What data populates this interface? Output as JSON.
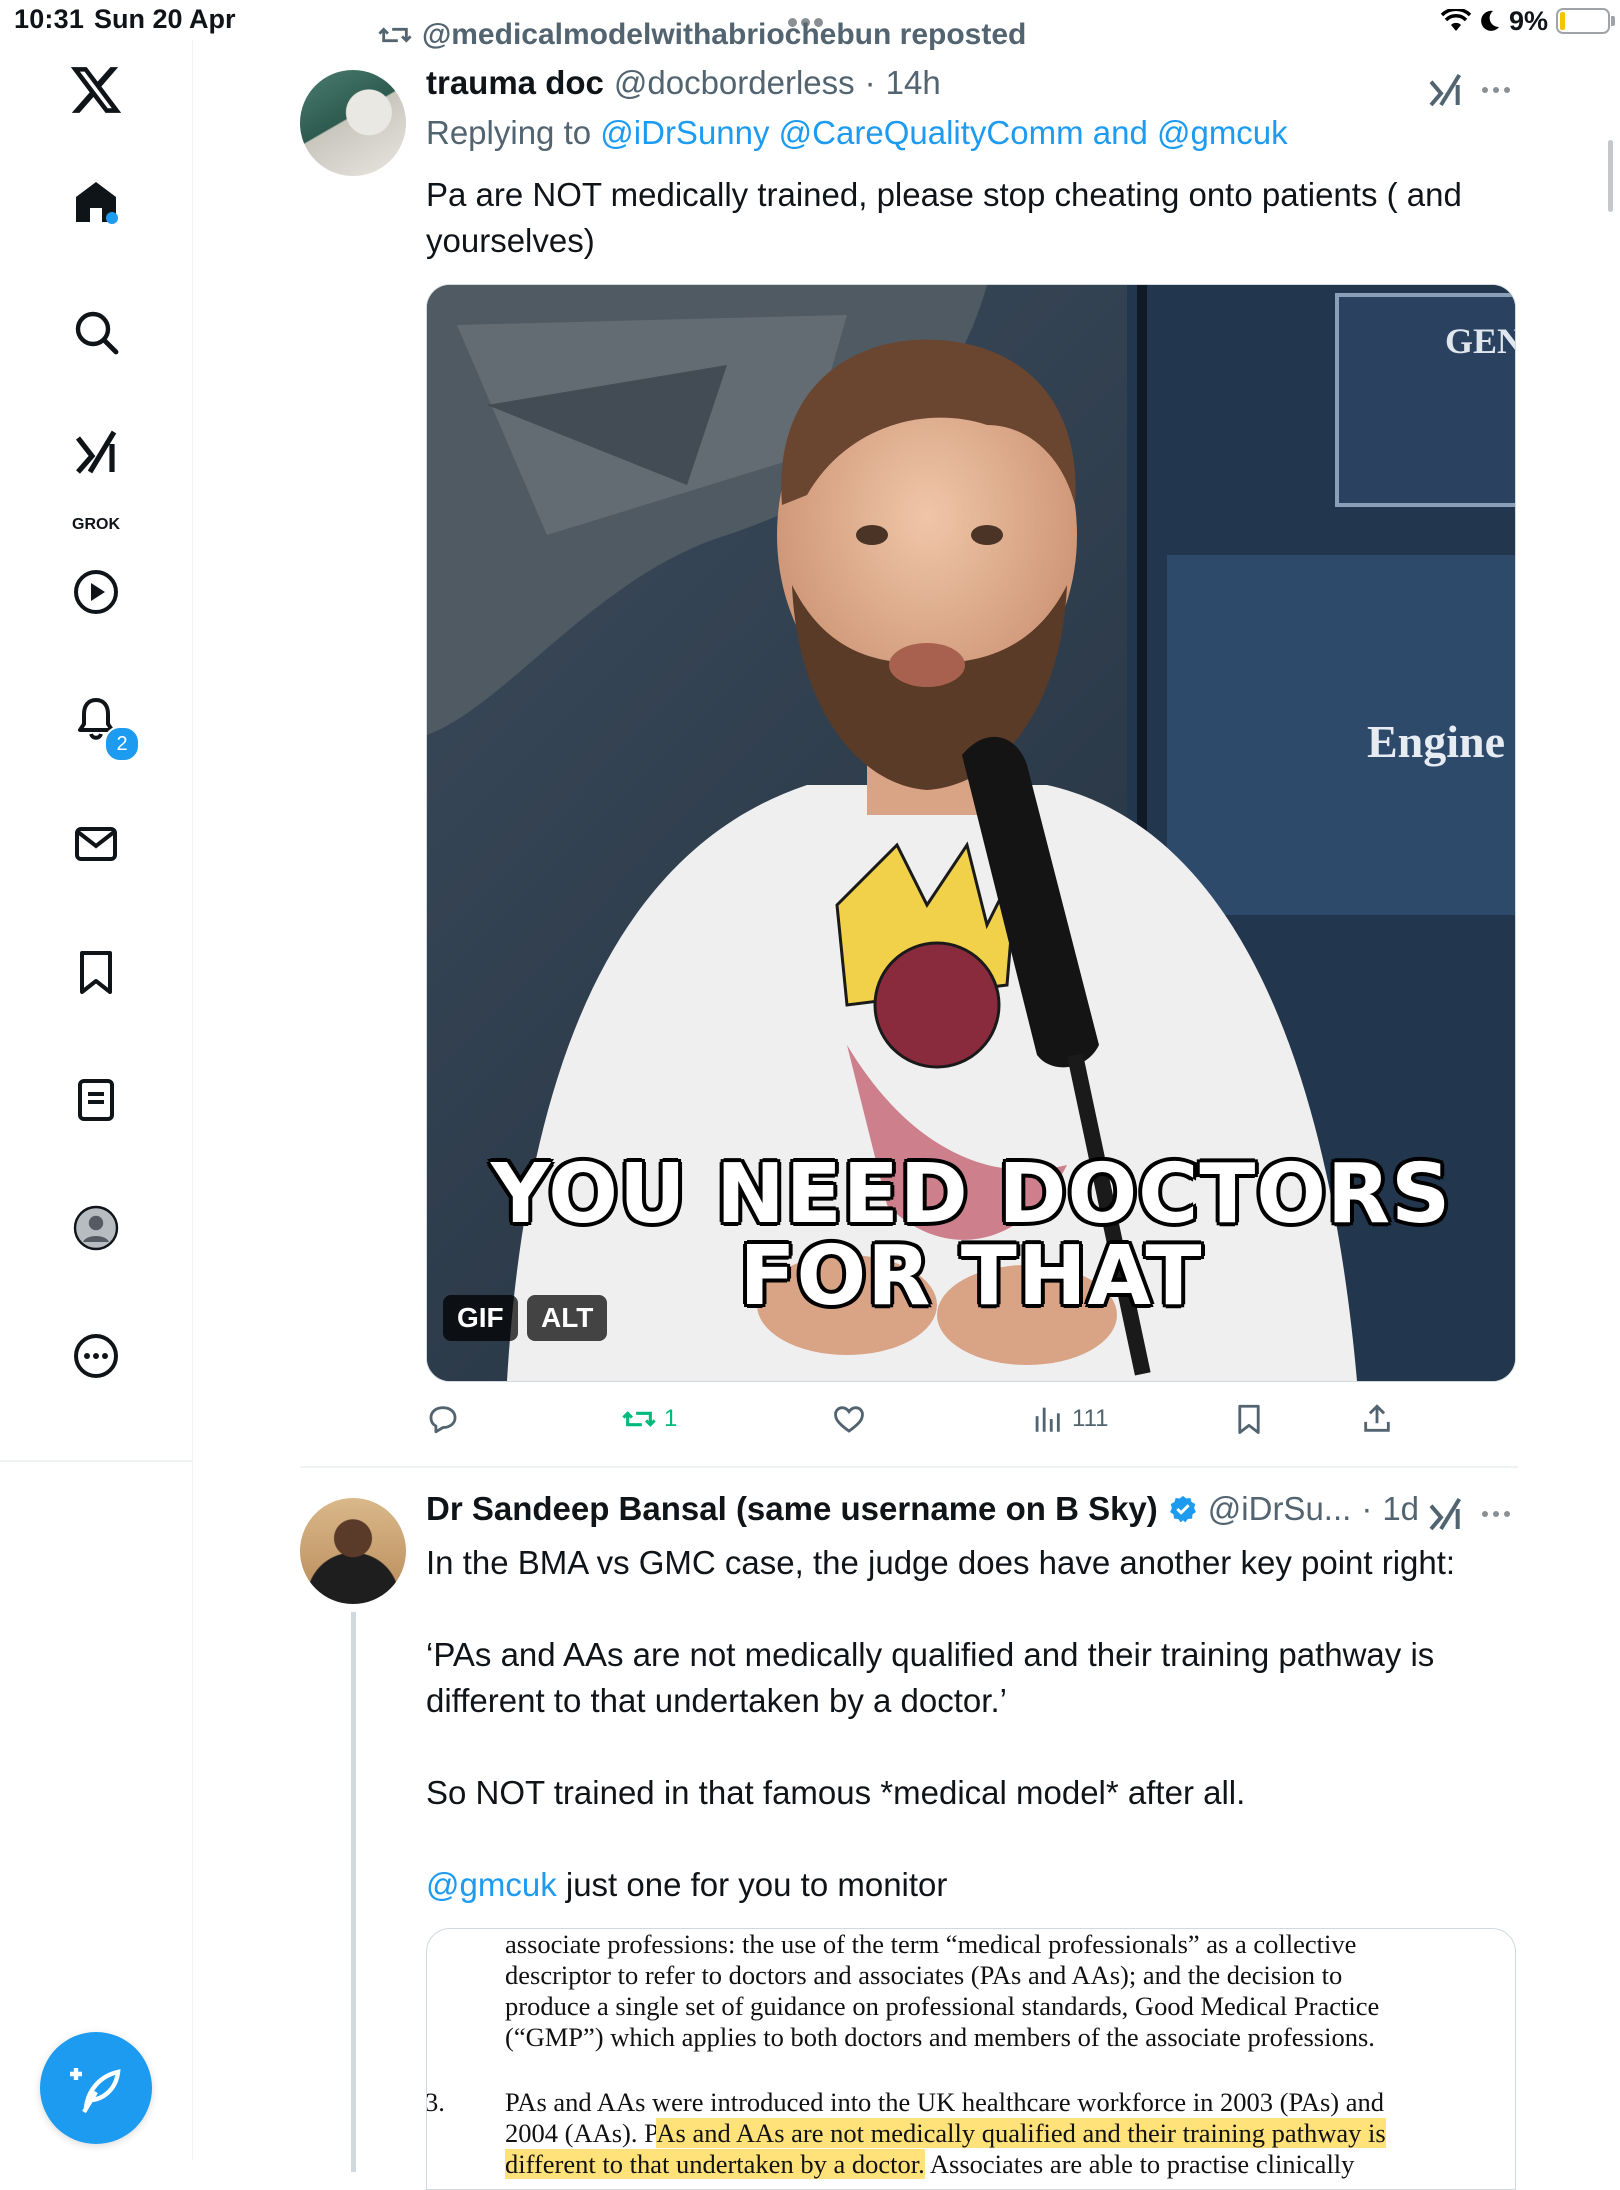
{
  "status_bar": {
    "time": "10:31",
    "date": "Sun 20 Apr",
    "battery": "9%"
  },
  "sidebar": {
    "items": [
      {
        "name": "home",
        "label": ""
      },
      {
        "name": "search",
        "label": ""
      },
      {
        "name": "grok",
        "label": "GROK"
      },
      {
        "name": "video",
        "label": ""
      },
      {
        "name": "notifications",
        "label": "",
        "badge": "2"
      },
      {
        "name": "messages",
        "label": ""
      },
      {
        "name": "bookmarks",
        "label": ""
      },
      {
        "name": "lists",
        "label": ""
      },
      {
        "name": "profile",
        "label": ""
      },
      {
        "name": "more",
        "label": ""
      }
    ]
  },
  "repost": {
    "text": "@medicalmodelwithabriochebun reposted"
  },
  "tweet1": {
    "name": "trauma doc",
    "handle": "@docborderless",
    "sep": "·",
    "time": "14h",
    "reply_prefix": "Replying to",
    "reply_mentions": "@iDrSunny @CareQualityComm and @gmcuk",
    "text": "Pa are NOT medically trained, please stop cheating onto patients ( and yourselves)",
    "media": {
      "caption_line1": "YOU NEED DOCTORS",
      "caption_line2": "FOR THAT",
      "sign_text_1": "GEN",
      "sign_text_2": "Engine",
      "badge_gif": "GIF",
      "badge_alt": "ALT"
    },
    "actions": {
      "replies": "",
      "reposts": "1",
      "likes": "",
      "views": "111"
    }
  },
  "tweet2": {
    "name": "Dr Sandeep Bansal (same username on B Sky)",
    "handle": "@iDrSu...",
    "sep": "·",
    "time": "1d",
    "para1": "In the BMA vs GMC case, the judge does have another key point right:",
    "para2": "‘PAs and AAs are not medically qualified and their training pathway is different to that undertaken by a doctor.’",
    "para3": "So NOT trained in that famous *medical model* after all.",
    "para4_mention": "@gmcuk",
    "para4_rest": " just one for you to monitor",
    "doc": {
      "line1": "associate professions: the use of the term “medical professionals” as a collective",
      "line2": "descriptor to refer to doctors and associates (PAs and AAs); and the decision to",
      "line3": "produce a single set of guidance on professional standards, Good Medical Practice",
      "line4": "(“GMP”) which applies to both doctors and members of the associate professions.",
      "num": "3.",
      "line5": "PAs and AAs were introduced into the UK healthcare workforce in 2003 (PAs) and",
      "line6a": "2004 (AAs).  P",
      "line6b": "As and AAs are not medically qualified and their training pathway is",
      "line7a": "different to that undertaken by a doctor.",
      "line7b": "  Associates are able to practise clinically"
    }
  },
  "colors": {
    "accent": "#1d9bf0",
    "repost_green": "#00ba7c",
    "text": "#0f1419",
    "muted": "#536471"
  }
}
